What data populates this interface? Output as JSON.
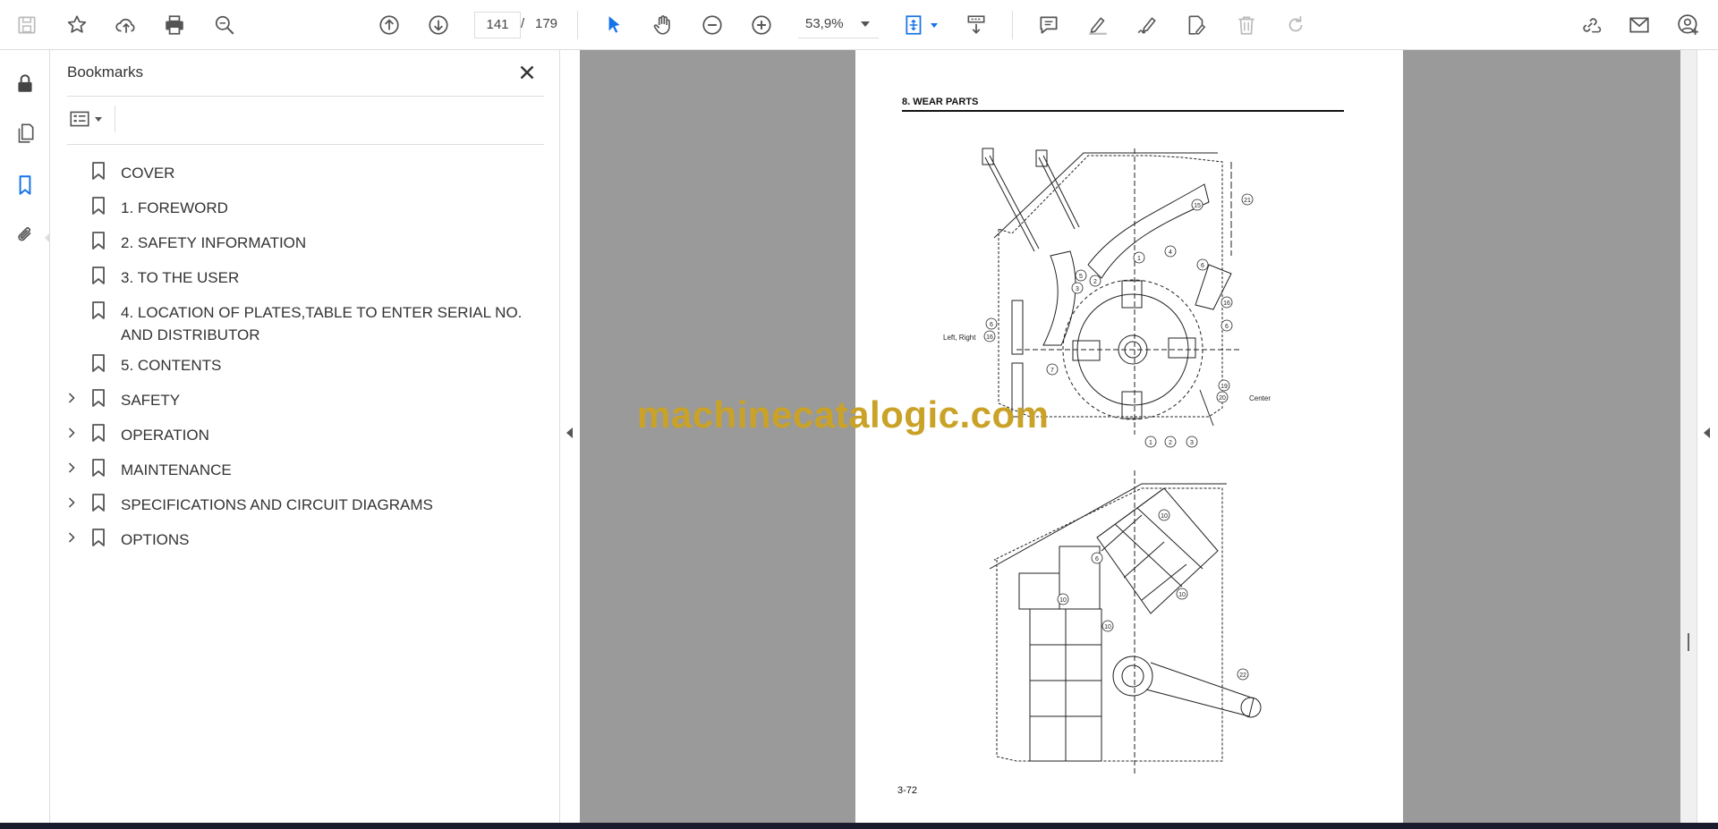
{
  "toolbar": {
    "current_page": "141",
    "page_separator": "/",
    "total_pages": "179",
    "zoom": "53,9%"
  },
  "bookmarks_panel": {
    "title": "Bookmarks",
    "items": [
      {
        "label": "COVER",
        "expandable": false
      },
      {
        "label": "1. FOREWORD",
        "expandable": false
      },
      {
        "label": "2. SAFETY INFORMATION",
        "expandable": false
      },
      {
        "label": "3. TO THE USER",
        "expandable": false
      },
      {
        "label": "4. LOCATION OF PLATES,TABLE TO ENTER SERIAL NO. AND DISTRIBUTOR",
        "expandable": false
      },
      {
        "label": "5. CONTENTS",
        "expandable": false
      },
      {
        "label": "SAFETY",
        "expandable": true
      },
      {
        "label": "OPERATION",
        "expandable": true
      },
      {
        "label": "MAINTENANCE",
        "expandable": true
      },
      {
        "label": "SPECIFICATIONS AND CIRCUIT DIAGRAMS",
        "expandable": true
      },
      {
        "label": "OPTIONS",
        "expandable": true
      }
    ]
  },
  "document": {
    "section_heading": "8.  WEAR PARTS",
    "page_number": "3-72",
    "labels": {
      "left_right": "Left, Right",
      "center": "Center"
    }
  },
  "watermark": "machinecatalogic.com",
  "colors": {
    "accent_blue": "#1473e6",
    "doc_background": "#9a9a9a",
    "watermark": "#c9a227"
  }
}
